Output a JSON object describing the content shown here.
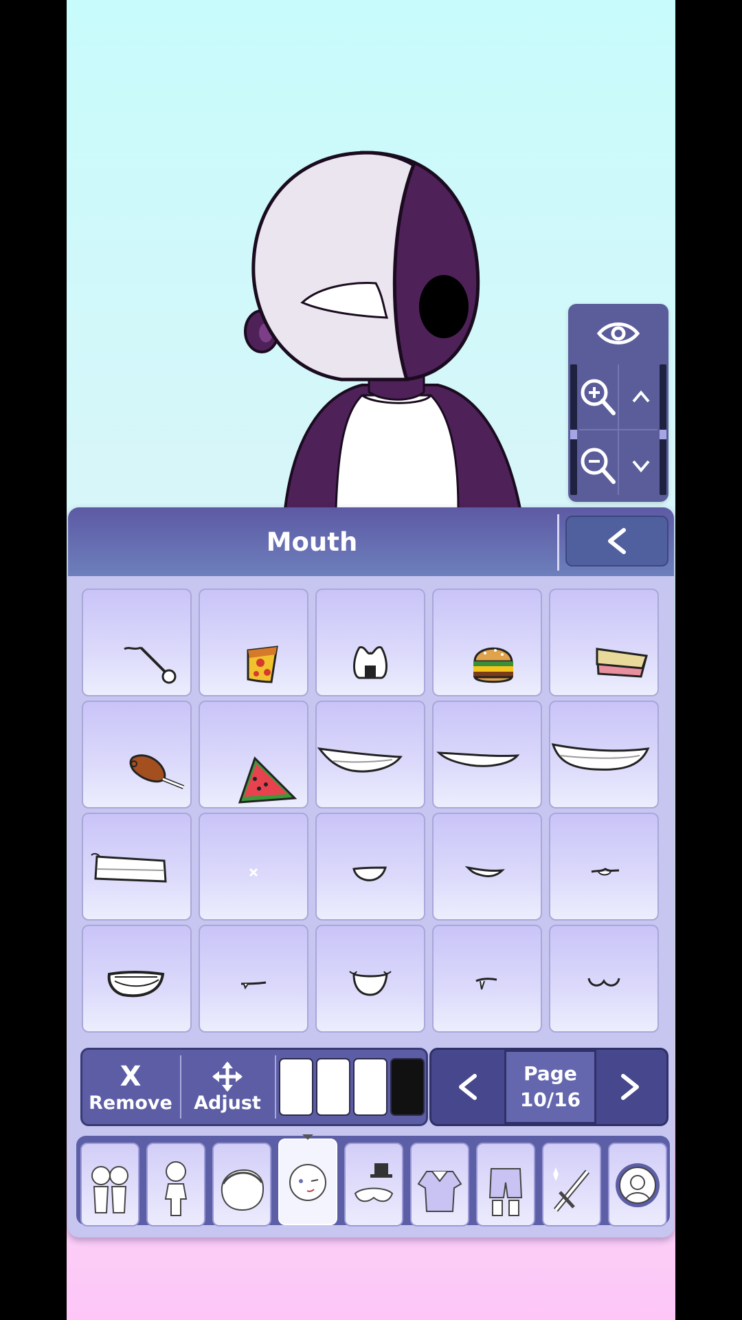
{
  "app": {
    "panel_title": "Mouth",
    "back_button": "<",
    "view_controls": {
      "preview_icon": "eye-icon",
      "zoom_in_icon": "zoom-in-icon",
      "zoom_out_icon": "zoom-out-icon",
      "up_icon": "chevron-up-icon",
      "down_icon": "chevron-down-icon"
    },
    "mouth_items": [
      {
        "icon": "lollipop-stick-icon"
      },
      {
        "icon": "pizza-slice-icon"
      },
      {
        "icon": "onigiri-icon"
      },
      {
        "icon": "hamburger-icon"
      },
      {
        "icon": "sandwich-icon"
      },
      {
        "icon": "chicken-leg-icon"
      },
      {
        "icon": "watermelon-slice-icon"
      },
      {
        "icon": "wide-grin-mouth-icon"
      },
      {
        "icon": "thin-smile-mouth-icon"
      },
      {
        "icon": "big-grin-mouth-icon"
      },
      {
        "icon": "clenched-teeth-mouth-icon"
      },
      {
        "icon": "none-x-icon"
      },
      {
        "icon": "small-open-mouth-icon"
      },
      {
        "icon": "small-smile-mouth-icon"
      },
      {
        "icon": "tiny-smirk-mouth-icon"
      },
      {
        "icon": "open-teeth-mouth-icon"
      },
      {
        "icon": "fang-line-mouth-icon"
      },
      {
        "icon": "open-smile-mouth-icon"
      },
      {
        "icon": "single-fang-mouth-icon"
      },
      {
        "icon": "cat-mouth-icon"
      }
    ],
    "toolbar": {
      "remove_label": "Remove",
      "remove_glyph": "X",
      "adjust_label": "Adjust",
      "swatch_colors": [
        "#ffffff",
        "#ffffff",
        "#ffffff",
        "#111111"
      ]
    },
    "pager": {
      "prev": "<",
      "next": ">",
      "page_label": "Page",
      "page_value": "10/16"
    },
    "categories": [
      {
        "icon": "preset-characters-icon"
      },
      {
        "icon": "body-icon"
      },
      {
        "icon": "hair-icon"
      },
      {
        "icon": "face-icon",
        "selected": true
      },
      {
        "icon": "accessory-mask-hat-icon"
      },
      {
        "icon": "top-shirt-icon"
      },
      {
        "icon": "bottoms-shorts-icon"
      },
      {
        "icon": "props-sword-icon"
      },
      {
        "icon": "profile-icon"
      }
    ],
    "colors": {
      "accent": "#5c5da4",
      "header_start": "#5d5aa4",
      "panel": "#c7c6f1",
      "character_skin": "#4f2159",
      "mask": "#ebe5ef"
    }
  }
}
